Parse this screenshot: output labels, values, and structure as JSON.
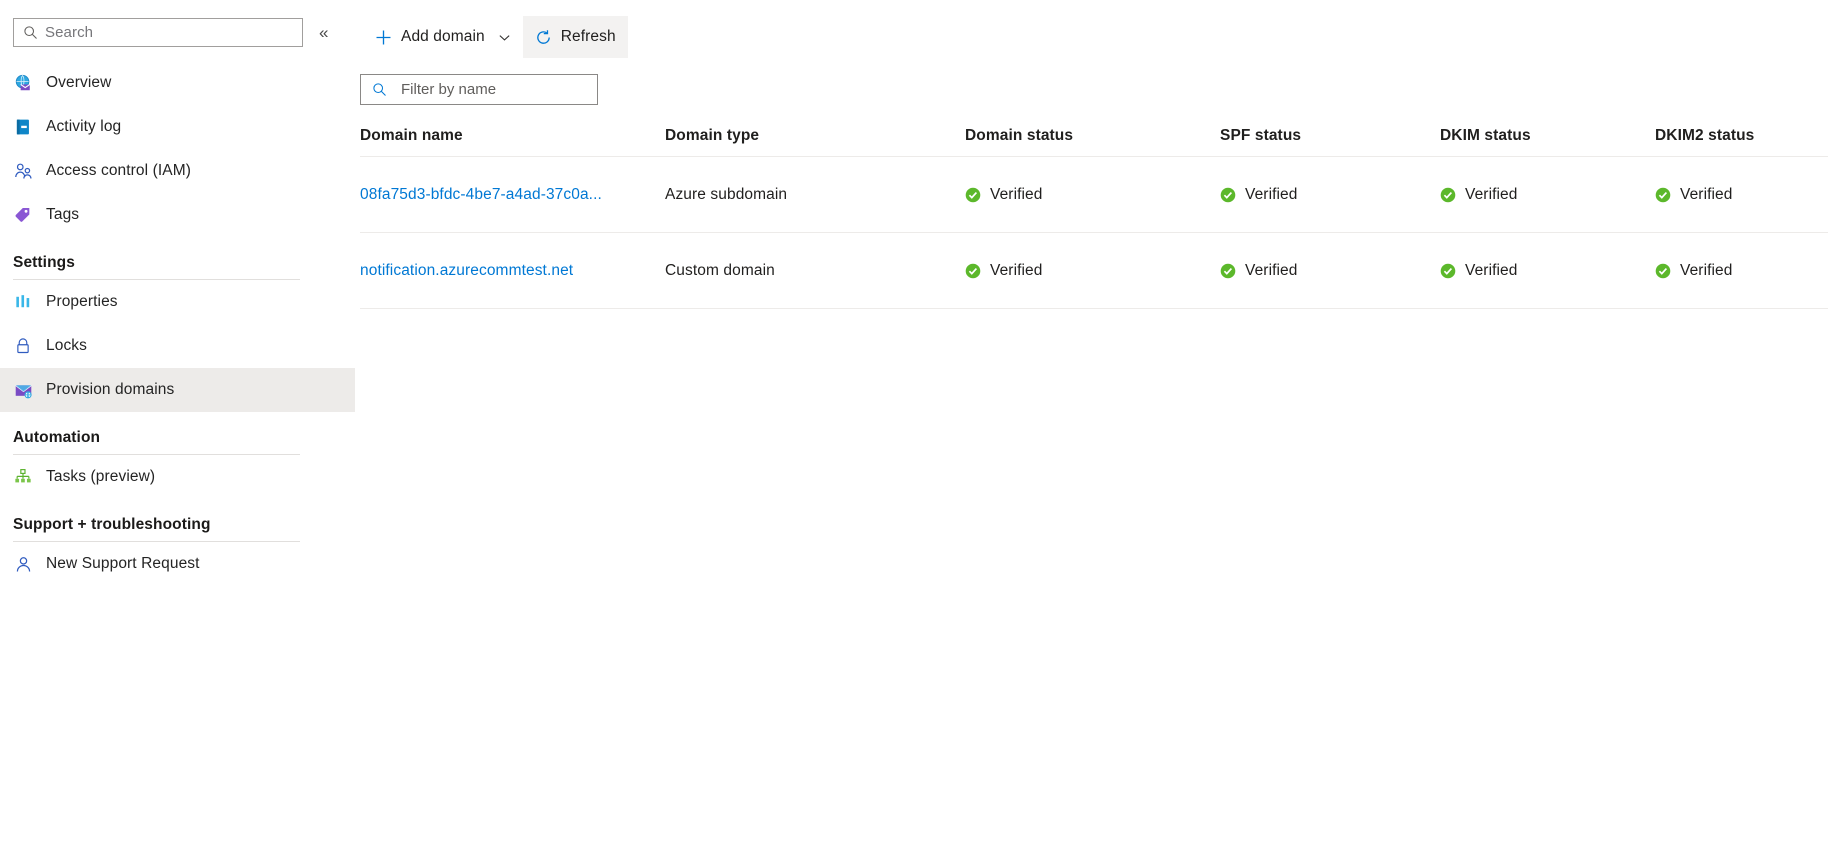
{
  "sidebar": {
    "search": {
      "placeholder": "Search",
      "icon": "search-icon"
    },
    "collapse": {
      "icon": "chevron-double-left-icon",
      "glyph": "«"
    },
    "items": [
      {
        "label": "Overview",
        "icon": "email-globe-icon",
        "selected": false
      },
      {
        "label": "Activity log",
        "icon": "activity-log-icon",
        "selected": false
      },
      {
        "label": "Access control (IAM)",
        "icon": "access-control-icon",
        "selected": false
      },
      {
        "label": "Tags",
        "icon": "tag-icon",
        "selected": false
      }
    ],
    "sections": [
      {
        "title": "Settings",
        "items": [
          {
            "label": "Properties",
            "icon": "properties-icon",
            "selected": false
          },
          {
            "label": "Locks",
            "icon": "lock-icon",
            "selected": false
          },
          {
            "label": "Provision domains",
            "icon": "provision-domains-icon",
            "selected": true
          }
        ]
      },
      {
        "title": "Automation",
        "items": [
          {
            "label": "Tasks (preview)",
            "icon": "tasks-icon",
            "selected": false
          }
        ]
      },
      {
        "title": "Support + troubleshooting",
        "items": [
          {
            "label": "New Support Request",
            "icon": "support-person-icon",
            "selected": false
          }
        ]
      }
    ]
  },
  "toolbar": {
    "add_domain_label": "Add domain",
    "add_domain_icon": "plus-icon",
    "add_domain_caret_icon": "chevron-down-icon",
    "refresh_label": "Refresh",
    "refresh_icon": "refresh-icon"
  },
  "filter": {
    "placeholder": "Filter by name",
    "value": "",
    "icon": "search-icon"
  },
  "table": {
    "columns": [
      "Domain name",
      "Domain type",
      "Domain status",
      "SPF status",
      "DKIM status",
      "DKIM2 status"
    ],
    "rows": [
      {
        "domain_name": "08fa75d3-bfdc-4be7-a4ad-37c0a...",
        "domain_type": "Azure subdomain",
        "domain_status": "Verified",
        "spf_status": "Verified",
        "dkim_status": "Verified",
        "dkim2_status": "Verified",
        "more_label": "···"
      },
      {
        "domain_name": "notification.azurecommtest.net",
        "domain_type": "Custom domain",
        "domain_status": "Verified",
        "spf_status": "Verified",
        "dkim_status": "Verified",
        "dkim2_status": "Verified",
        "more_label": "···"
      }
    ]
  },
  "colors": {
    "link": "#0078d4",
    "verified_green": "#5cb82b",
    "selected_row": "#edebe9",
    "divider": "#edebe9"
  }
}
